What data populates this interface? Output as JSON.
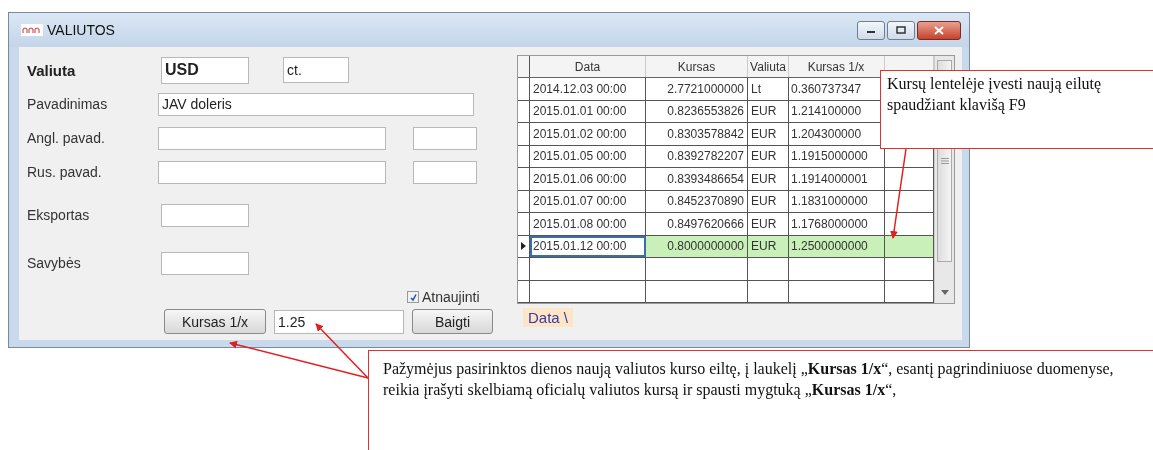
{
  "window": {
    "title": "VALIUTOS"
  },
  "form": {
    "currency_label": "Valiuta",
    "currency_code": "USD",
    "unit": "ct.",
    "fields": [
      {
        "label": "Pavadinimas",
        "value": "JAV doleris",
        "kind": "wide"
      },
      {
        "label": "Angl. pavad.",
        "kind": "pair"
      },
      {
        "label": "Rus. pavad.",
        "kind": "pair"
      },
      {
        "label": "Eksportas",
        "kind": "short"
      },
      {
        "label": "Savybės",
        "kind": "short"
      }
    ],
    "checkbox": {
      "label": "Atnaujinti",
      "checked": true
    },
    "rate_button": "Kursas 1/x",
    "rate_value": "1.25",
    "finish_button": "Baigti"
  },
  "table": {
    "columns": [
      "Data",
      "Kursas",
      "Valiuta",
      "Kursas 1/x"
    ],
    "rows": [
      {
        "cells": [
          "2014.12.03 00:00",
          "2.7721000000",
          "Lt",
          "0.360737347"
        ],
        "selected": false
      },
      {
        "cells": [
          "2015.01.01 00:00",
          "0.8236553826",
          "EUR",
          "1.214100000"
        ],
        "selected": false
      },
      {
        "cells": [
          "2015.01.02 00:00",
          "0.8303578842",
          "EUR",
          "1.204300000"
        ],
        "selected": false
      },
      {
        "cells": [
          "2015.01.05 00:00",
          "0.8392782207",
          "EUR",
          "1.1915000000"
        ],
        "selected": false
      },
      {
        "cells": [
          "2015.01.06 00:00",
          "0.8393486654",
          "EUR",
          "1.1914000001"
        ],
        "selected": false
      },
      {
        "cells": [
          "2015.01.07 00:00",
          "0.8452370890",
          "EUR",
          "1.1831000000"
        ],
        "selected": false
      },
      {
        "cells": [
          "2015.01.08 00:00",
          "0.8497620666",
          "EUR",
          "1.1768000000"
        ],
        "selected": false
      },
      {
        "cells": [
          "2015.01.12 00:00",
          "0.8000000000",
          "EUR",
          "1.2500000000"
        ],
        "selected": true
      }
    ],
    "tab": "Data \\"
  },
  "callouts": [
    {
      "text": "Kursų lentelėje įvesti naują eilutę spaudžiant klavišą F9"
    },
    {
      "text": "Pažymėjus pasirinktos dienos naują valiutos kurso eiltę, į laukelį „**Kursas 1/x**“, esantį pagrindiniuose duomenyse, reikia įrašyti skelbiamą  oficialų valiutos kursą ir spausti mygtuką „**Kursas 1/x**“,"
    }
  ]
}
